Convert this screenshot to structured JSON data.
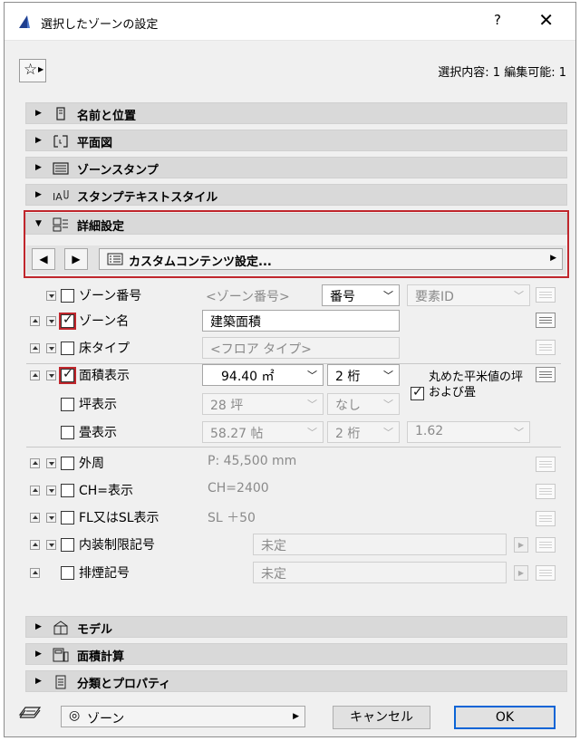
{
  "window": {
    "title": "選択したゾーンの設定",
    "help_label": "?",
    "close_label": "✕",
    "selection_info": "選択内容: 1 編集可能: 1"
  },
  "sections_top": [
    {
      "label": "名前と位置",
      "icon": "name-position-icon"
    },
    {
      "label": "平面図",
      "icon": "floor-plan-icon"
    },
    {
      "label": "ゾーンスタンプ",
      "icon": "zone-stamp-icon"
    },
    {
      "label": "スタンプテキストスタイル",
      "icon": "stamp-text-style-icon"
    },
    {
      "label": "詳細設定",
      "icon": "details-icon"
    }
  ],
  "detail": {
    "page_label": "カスタムコンテンツ設定...",
    "rows": {
      "zone_number": {
        "label": "ゾーン番号",
        "value": "<ゾーン番号>",
        "type": "番号",
        "id_placeholder": "要素ID"
      },
      "zone_name": {
        "label": "ゾーン名",
        "value": "建築面積"
      },
      "floor_type": {
        "label": "床タイプ",
        "value": "<フロア タイプ>"
      },
      "area_display": {
        "label": "面積表示",
        "value": "94.40 ㎡",
        "digits": "2 桁",
        "rounding_label": "丸めた平米値の坪および畳"
      },
      "tsubo_display": {
        "label": "坪表示",
        "value": "28 坪",
        "digits": "なし"
      },
      "tatami_display": {
        "label": "畳表示",
        "value": "58.27 帖",
        "digits": "2 桁",
        "factor": "1.62"
      },
      "perimeter": {
        "label": "外周",
        "value": "P: 45,500 mm"
      },
      "ch_display": {
        "label": "CH=表示",
        "value": "CH=2400"
      },
      "fl_sl_display": {
        "label": "FL又はSL表示",
        "value": "SL ＋50"
      },
      "interior_mark": {
        "label": "内装制限記号",
        "value": "未定"
      },
      "smoke_mark": {
        "label": "排煙記号",
        "value": "未定"
      }
    }
  },
  "sections_bottom": [
    {
      "label": "モデル",
      "icon": "model-icon"
    },
    {
      "label": "面積計算",
      "icon": "area-calc-icon"
    },
    {
      "label": "分類とプロパティ",
      "icon": "classification-icon"
    }
  ],
  "footer": {
    "layer": "ゾーン",
    "cancel_label": "キャンセル",
    "ok_label": "OK"
  },
  "colors": {
    "highlight": "#c0262c",
    "section_bg": "#d9d9d9",
    "ok_border": "#0a64d6"
  }
}
